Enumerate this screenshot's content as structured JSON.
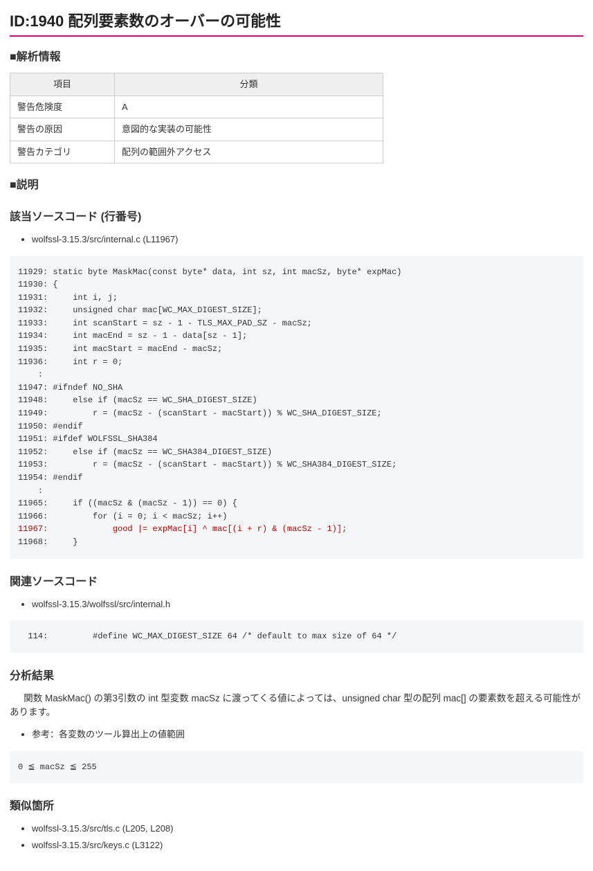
{
  "title": "ID:1940 配列要素数のオーバーの可能性",
  "sections": {
    "analysis_info_header": "■解析情報",
    "description_header": "■説明",
    "source_code_header": "該当ソースコード (行番号)",
    "related_source_header": "関連ソースコード",
    "analysis_result_header": "分析結果",
    "similar_locations_header": "類似箇所"
  },
  "info_table": {
    "col1": "項目",
    "col2": "分類",
    "rows": [
      {
        "label": "警告危険度",
        "value": "A"
      },
      {
        "label": "警告の原因",
        "value": "意図的な実装の可能性"
      },
      {
        "label": "警告カテゴリ",
        "value": "配列の範囲外アクセス"
      }
    ]
  },
  "source_file": "wolfssl-3.15.3/src/internal.c (L11967)",
  "code_block_1": {
    "lines": [
      "11929: static byte MaskMac(const byte* data, int sz, int macSz, byte* expMac)",
      "11930: {",
      "11931:     int i, j;",
      "11932:     unsigned char mac[WC_MAX_DIGEST_SIZE];",
      "11933:     int scanStart = sz - 1 - TLS_MAX_PAD_SZ - macSz;",
      "11934:     int macEnd = sz - 1 - data[sz - 1];",
      "11935:     int macStart = macEnd - macSz;",
      "11936:     int r = 0;",
      "    :",
      "11947: #ifndef NO_SHA",
      "11948:     else if (macSz == WC_SHA_DIGEST_SIZE)",
      "11949:         r = (macSz - (scanStart - macStart)) % WC_SHA_DIGEST_SIZE;",
      "11950: #endif",
      "11951: #ifdef WOLFSSL_SHA384",
      "11952:     else if (macSz == WC_SHA384_DIGEST_SIZE)",
      "11953:         r = (macSz - (scanStart - macStart)) % WC_SHA384_DIGEST_SIZE;",
      "11954: #endif",
      "    :",
      "11965:     if ((macSz & (macSz - 1)) == 0) {",
      "11966:         for (i = 0; i < macSz; i++)"
    ],
    "highlight": "11967:             good |= expMac[i] ^ mac[(i + r) & (macSz - 1)];",
    "after": "11968:     }"
  },
  "related_source_file": "wolfssl-3.15.3/wolfssl/src/internal.h",
  "code_block_2": "  114:         #define WC_MAX_DIGEST_SIZE 64 /* default to max size of 64 */",
  "analysis_text": "関数 MaskMac() の第3引数の int 型変数 macSz に渡ってくる値によっては、unsigned char 型の配列 mac[] の要素数を超える可能性があります。",
  "reference_note": "参考：各変数のツール算出上の値範囲",
  "code_block_3": "0 ≦ macSz ≦ 255",
  "similar_locations": [
    "wolfssl-3.15.3/src/tls.c (L205, L208)",
    "wolfssl-3.15.3/src/keys.c (L3122)"
  ]
}
